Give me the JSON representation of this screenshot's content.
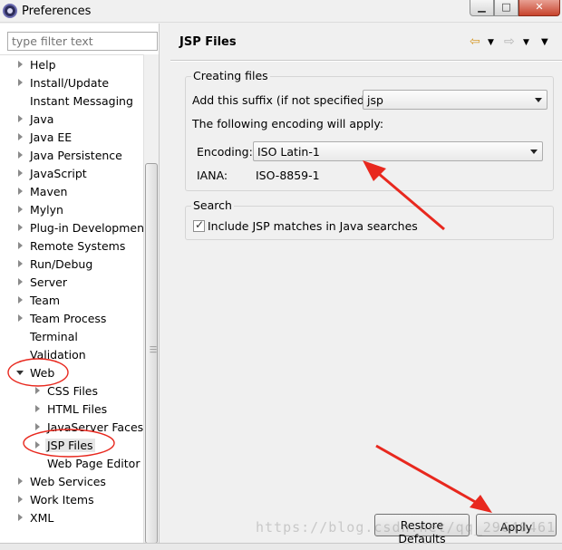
{
  "window": {
    "title": "Preferences"
  },
  "sidebar": {
    "filter_placeholder": "type filter text",
    "items": [
      {
        "label": "Help",
        "arrow": true
      },
      {
        "label": "Install/Update",
        "arrow": true
      },
      {
        "label": "Instant Messaging",
        "arrow": false
      },
      {
        "label": "Java",
        "arrow": true
      },
      {
        "label": "Java EE",
        "arrow": true
      },
      {
        "label": "Java Persistence",
        "arrow": true
      },
      {
        "label": "JavaScript",
        "arrow": true
      },
      {
        "label": "Maven",
        "arrow": true
      },
      {
        "label": "Mylyn",
        "arrow": true
      },
      {
        "label": "Plug-in Development",
        "arrow": true
      },
      {
        "label": "Remote Systems",
        "arrow": true
      },
      {
        "label": "Run/Debug",
        "arrow": true
      },
      {
        "label": "Server",
        "arrow": true
      },
      {
        "label": "Team",
        "arrow": true
      },
      {
        "label": "Team Process",
        "arrow": true
      },
      {
        "label": "Terminal",
        "arrow": false
      },
      {
        "label": "Validation",
        "arrow": false
      },
      {
        "label": "Web",
        "arrow": "open"
      },
      {
        "label": "CSS Files",
        "arrow": true,
        "child": true
      },
      {
        "label": "HTML Files",
        "arrow": true,
        "child": true
      },
      {
        "label": "JavaServer Faces T",
        "arrow": true,
        "child": true
      },
      {
        "label": "JSP Files",
        "arrow": true,
        "child": true,
        "selected": true
      },
      {
        "label": "Web Page Editor",
        "arrow": false,
        "child": true
      },
      {
        "label": "Web Services",
        "arrow": true
      },
      {
        "label": "Work Items",
        "arrow": true
      },
      {
        "label": "XML",
        "arrow": true
      }
    ]
  },
  "page": {
    "title": "JSP Files",
    "creating_files": {
      "group_label": "Creating files",
      "suffix_label": "Add this suffix (if not specified):",
      "suffix_value": "jsp",
      "encoding_note": "The following encoding will apply:",
      "encoding_label": "Encoding:",
      "encoding_value": "ISO Latin-1",
      "iana_label": "IANA:",
      "iana_value": "ISO-8859-1"
    },
    "search": {
      "group_label": "Search",
      "include_label": "Include JSP matches in Java searches",
      "include_checked": true
    },
    "buttons": {
      "restore": "Restore Defaults",
      "apply": "Apply"
    }
  },
  "watermark": "https://blog.csdn.net/qq_29640461",
  "colors": {
    "annotation": "#e8281e"
  }
}
